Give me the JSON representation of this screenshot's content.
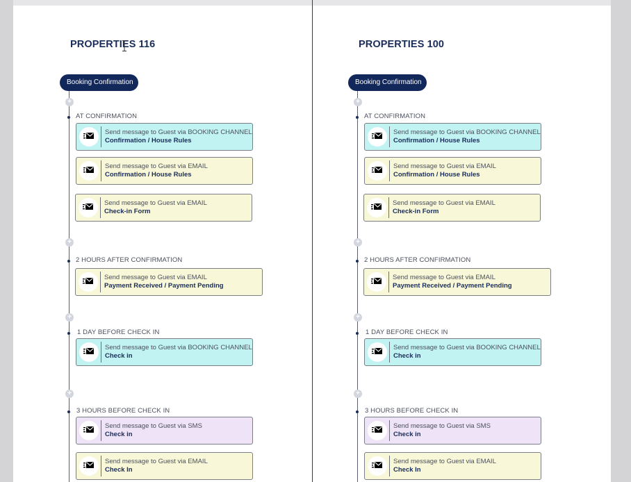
{
  "columns": [
    {
      "title": "PROPERTIES 116",
      "trigger": "Booking Confirmation",
      "groups": [
        {
          "label": "AT CONFIRMATION",
          "cards": [
            {
              "line1": "Send message to Guest via BOOKING CHANNEL",
              "line2": "Confirmation / House Rules",
              "color": "cyan"
            },
            {
              "line1": "Send message to Guest via EMAIL",
              "line2": "Confirmation / House Rules",
              "color": "yellow"
            },
            {
              "line1": "Send message to Guest via EMAIL",
              "line2": "Check-in Form",
              "color": "yellow"
            }
          ]
        },
        {
          "label": "2 HOURS AFTER CONFIRMATION",
          "cards": [
            {
              "line1": "Send message to Guest via EMAIL",
              "line2": "Payment Received / Payment Pending",
              "color": "yellow"
            }
          ]
        },
        {
          "label": "1 DAY BEFORE CHECK IN",
          "cards": [
            {
              "line1": "Send message to Guest via BOOKING CHANNEL",
              "line2": "Check in",
              "color": "cyan"
            }
          ]
        },
        {
          "label": "3 HOURS BEFORE CHECK IN",
          "cards": [
            {
              "line1": "Send message to Guest via SMS",
              "line2": "Check in",
              "color": "purple"
            },
            {
              "line1": "Send message to Guest via EMAIL",
              "line2": "Check In",
              "color": "yellow"
            }
          ]
        }
      ]
    },
    {
      "title": "PROPERTIES 100",
      "trigger": "Booking Confirmation",
      "groups": [
        {
          "label": "AT CONFIRMATION",
          "cards": [
            {
              "line1": "Send message to Guest via BOOKING CHANNEL",
              "line2": "Confirmation / House Rules",
              "color": "cyan"
            },
            {
              "line1": "Send message to Guest via EMAIL",
              "line2": "Confirmation / House Rules",
              "color": "yellow"
            },
            {
              "line1": "Send message to Guest via EMAIL",
              "line2": "Check-in Form",
              "color": "yellow"
            }
          ]
        },
        {
          "label": "2 HOURS AFTER CONFIRMATION",
          "cards": [
            {
              "line1": "Send message to Guest via EMAIL",
              "line2": "Payment Received / Payment Pending",
              "color": "yellow"
            }
          ]
        },
        {
          "label": "1 DAY BEFORE CHECK IN",
          "cards": [
            {
              "line1": "Send message to Guest via BOOKING CHANNEL",
              "line2": "Check in",
              "color": "cyan"
            }
          ]
        },
        {
          "label": "3 HOURS BEFORE CHECK IN",
          "cards": [
            {
              "line1": "Send message to Guest via SMS",
              "line2": "Check in",
              "color": "purple"
            },
            {
              "line1": "Send message to Guest via EMAIL",
              "line2": "Check In",
              "color": "yellow"
            }
          ]
        }
      ]
    }
  ],
  "colors": {
    "cyan": "#c1f3f2",
    "yellow": "#f8f7d7",
    "purple": "#efe3f7",
    "navy": "#13285a"
  },
  "icons": {
    "message": "envelope-send-icon",
    "add": "plus-icon",
    "cursor": "text-cursor-icon"
  }
}
